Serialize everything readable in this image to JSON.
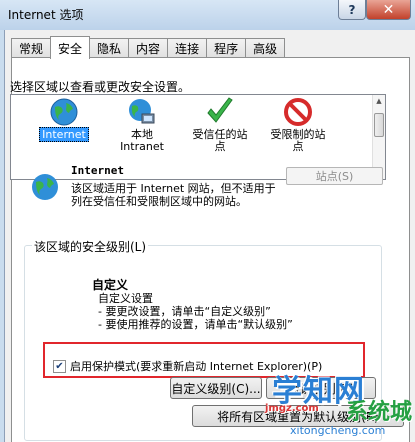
{
  "window": {
    "title": "Internet 选项",
    "help_label": "?",
    "close_label": "✕"
  },
  "tabs": [
    {
      "label": "常规",
      "active": false
    },
    {
      "label": "安全",
      "active": true
    },
    {
      "label": "隐私",
      "active": false
    },
    {
      "label": "内容",
      "active": false
    },
    {
      "label": "连接",
      "active": false
    },
    {
      "label": "程序",
      "active": false
    },
    {
      "label": "高级",
      "active": false
    }
  ],
  "security": {
    "zone_prompt": "选择区域以查看或更改安全设置。",
    "zones": [
      {
        "label": "Internet",
        "icon": "globe-icon",
        "selected": true
      },
      {
        "label": "本地\nIntranet",
        "icon": "intranet-globe-icon",
        "selected": false
      },
      {
        "label": "受信任的站\n点",
        "icon": "checkmark-icon",
        "selected": false
      },
      {
        "label": "受限制的站\n点",
        "icon": "prohibited-icon",
        "selected": false
      }
    ],
    "selected_zone": {
      "name": "Internet",
      "description": "该区域适用于 Internet 网站，但不适用于列在受信任和受限制区域中的网站。",
      "sites_button": "站点(S)"
    },
    "level_group_title": "该区域的安全级别(L)",
    "level_name": "自定义",
    "level_description": [
      "自定义设置",
      "- 要更改设置，请单击“自定义级别”",
      "- 要使用推荐的设置，请单击“默认级别”"
    ],
    "protected_mode": {
      "label": "启用保护模式(要求重新启动 Internet Explorer)(P)",
      "checked": true
    },
    "custom_level_button": "自定义级别(C)...",
    "default_level_button": "默认级别(D)",
    "reset_all_button": "将所有区域重置为默认级别(R)"
  },
  "watermark": {
    "main": "学知网",
    "sub": "系统城",
    "red": "jmgz.com",
    "url": "xitongcheng.com"
  },
  "colors": {
    "selection": "#3399ff",
    "highlight_border": "#e1262c",
    "titlebar": "#bcd2ea"
  }
}
